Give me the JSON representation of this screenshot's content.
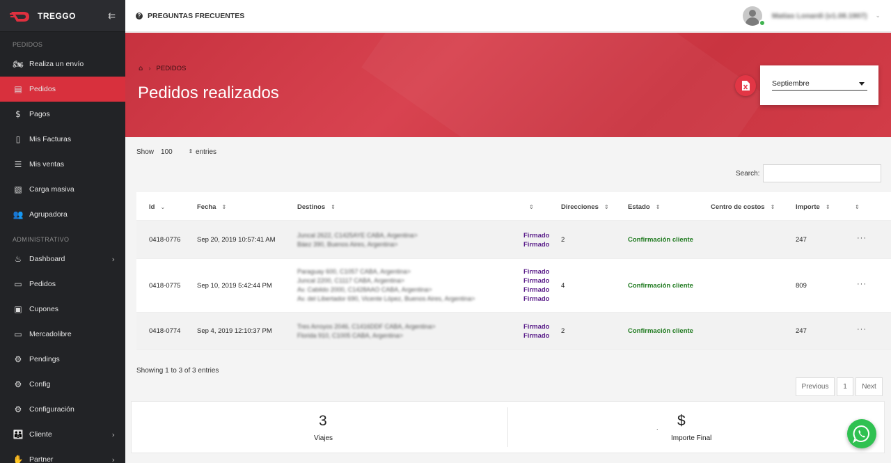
{
  "brand": {
    "name": "TREGGO",
    "accent": "#d8303d"
  },
  "sidebar": {
    "sections": [
      {
        "title": "PEDIDOS",
        "items": [
          {
            "label": "Realiza un envío",
            "icon": "motorcycle-icon"
          },
          {
            "label": "Pedidos",
            "icon": "documents-icon",
            "active": true
          },
          {
            "label": "Pagos",
            "icon": "dollar-icon"
          },
          {
            "label": "Mis Facturas",
            "icon": "pdf-file-icon"
          },
          {
            "label": "Mis ventas",
            "icon": "list-icon"
          },
          {
            "label": "Carga masiva",
            "icon": "excel-file-icon"
          },
          {
            "label": "Agrupadora",
            "icon": "users-icon"
          }
        ]
      },
      {
        "title": "ADMINISTRATIVO",
        "items": [
          {
            "label": "Dashboard",
            "icon": "fire-icon",
            "chevron": true
          },
          {
            "label": "Pedidos",
            "icon": "money-icon"
          },
          {
            "label": "Cupones",
            "icon": "briefcase-icon"
          },
          {
            "label": "Mercadolibre",
            "icon": "money-icon"
          },
          {
            "label": "Pendings",
            "icon": "gear-icon"
          },
          {
            "label": "Config",
            "icon": "gear-icon"
          },
          {
            "label": "Configuración",
            "icon": "gears-icon"
          },
          {
            "label": "Cliente",
            "icon": "people-icon",
            "chevron": true
          },
          {
            "label": "Partner",
            "icon": "handshake-icon",
            "chevron": true
          }
        ]
      }
    ]
  },
  "topbar": {
    "faq_label": "PREGUNTAS FRECUENTES",
    "user_name": "Matias Lonardi (v1.08.1907)"
  },
  "hero": {
    "breadcrumb": "PEDIDOS",
    "title": "Pedidos realizados",
    "month": "Septiembre"
  },
  "table_controls": {
    "show_label": "Show",
    "length_value": "100",
    "entries_label": "entries",
    "search_label": "Search:"
  },
  "table": {
    "columns": [
      "Id",
      "Fecha",
      "Destinos",
      "",
      "Direcciones",
      "Estado",
      "Centro de costos",
      "Importe",
      ""
    ],
    "rows": [
      {
        "id": "0418-0776",
        "fecha": "Sep 20, 2019 10:57:41 AM",
        "destinos": [
          "Juncal 2622, C1425AYE CABA, Argentina>",
          "Báez 390, Buenos Aires, Argentina>"
        ],
        "firmas": [
          "Firmado",
          "Firmado"
        ],
        "direcciones": "2",
        "estado": "Confirmación cliente",
        "centro": "",
        "importe": "247",
        "more": "···"
      },
      {
        "id": "0418-0775",
        "fecha": "Sep 10, 2019 5:42:44 PM",
        "destinos": [
          "Paraguay 600, C1057 CABA, Argentina>",
          "Juncal 2200, C1117 CABA, Argentina>",
          "Av. Cabildo 2000, C1428AAO CABA, Argentina>",
          "Av. del Libertador 690, Vicente López, Buenos Aires, Argentina>"
        ],
        "firmas": [
          "Firmado",
          "Firmado",
          "Firmado",
          "Firmado"
        ],
        "direcciones": "4",
        "estado": "Confirmación cliente",
        "centro": "",
        "importe": "809",
        "more": "···"
      },
      {
        "id": "0418-0774",
        "fecha": "Sep 4, 2019 12:10:37 PM",
        "destinos": [
          "Tres Arroyos 2046, C1416DDF CABA, Argentina>",
          "Florida 910, C1005 CABA, Argentina>"
        ],
        "firmas": [
          "Firmado",
          "Firmado"
        ],
        "direcciones": "2",
        "estado": "Confirmación cliente",
        "centro": "",
        "importe": "247",
        "more": "···"
      }
    ]
  },
  "footer": {
    "showing": "Showing 1 to 3 of 3 entries",
    "pager": {
      "previous": "Previous",
      "page": "1",
      "next": "Next"
    }
  },
  "stats": {
    "viajes_value": "3",
    "viajes_label": "Viajes",
    "dot": ".",
    "importe_value": "$",
    "importe_label": "Importe Final"
  },
  "colors": {
    "sidebar_bg": "#222326",
    "hero": "#d23c48",
    "firmado": "#5b1f8a",
    "estado": "#1f7a1f",
    "whatsapp": "#2fc151"
  }
}
